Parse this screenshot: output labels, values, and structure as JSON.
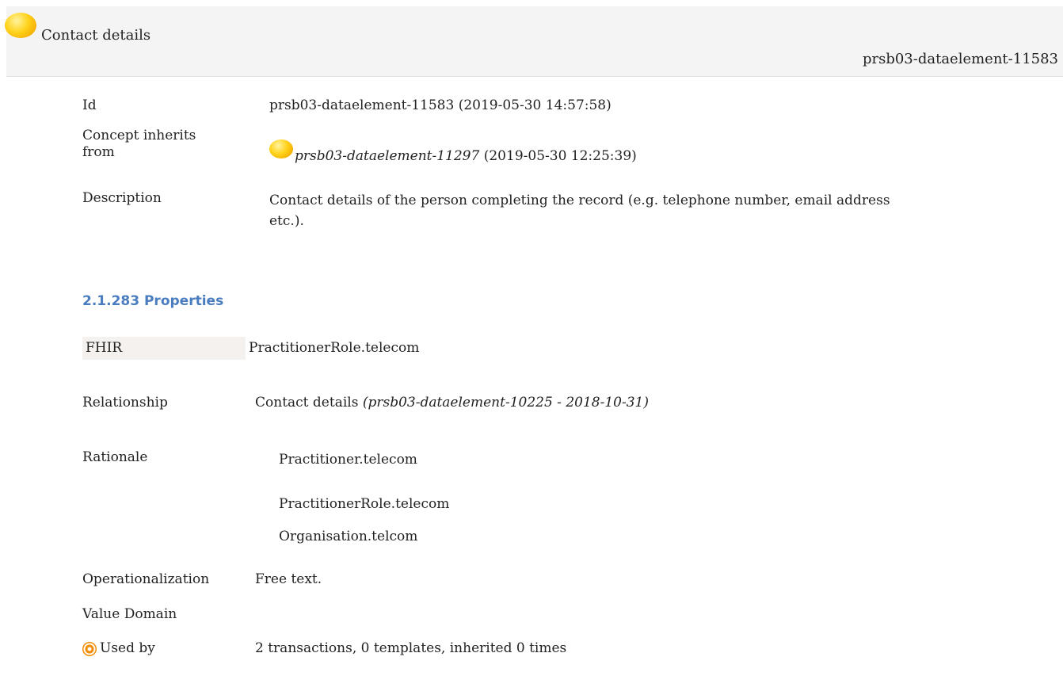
{
  "header": {
    "title": "Contact details",
    "id": "prsb03-dataelement-11583"
  },
  "details": {
    "id_label": "Id",
    "id_value": "prsb03-dataelement-11583 (2019-05-30 14:57:58)",
    "inherits_label_line1": "Concept inherits",
    "inherits_label_line2": "from",
    "inherits_ref": "prsb03-dataelement-11297",
    "inherits_date": "(2019-05-30 12:25:39)",
    "description_label": "Description",
    "description_line1": "Contact details of the person completing the record (e.g. telephone number, email address",
    "description_line2": "etc.)."
  },
  "properties": {
    "section_title": "2.1.283 Properties",
    "fhir_label": "FHIR",
    "fhir_value": "PractitionerRole.telecom",
    "relationship_label": "Relationship",
    "relationship_value": "Contact details",
    "relationship_ref": "(prsb03-dataelement-10225 - 2018-10-31)",
    "rationale_label": "Rationale",
    "rationale_lines": [
      "Practitioner.telecom",
      "PractitionerRole.telecom",
      "Organisation.telcom"
    ],
    "operationalization_label": "Operationalization",
    "operationalization_value": "Free text.",
    "value_domain_label": "Value Domain",
    "used_by_label": "Used by",
    "used_by_value": "2 transactions, 0 templates, inherited 0 times"
  },
  "colors": {
    "section_title": "#4a7dbf",
    "header_bg": "#f4f4f4",
    "orb": "#ffd21a",
    "used_by_icon": "#f08a00"
  },
  "icons": {
    "concept_status": "yellow-orb-icon",
    "used_by": "target-icon"
  }
}
